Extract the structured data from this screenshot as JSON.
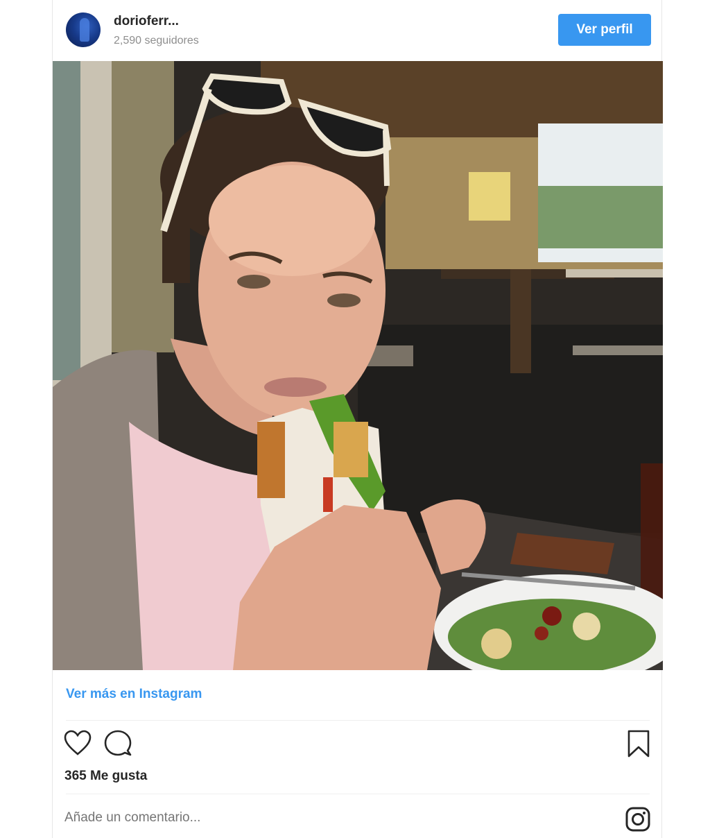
{
  "header": {
    "username": "dorioferr...",
    "followers": "2,590 seguidores",
    "profile_button": "Ver perfil"
  },
  "post": {
    "more_link": "Ver más en Instagram",
    "likes": "365 Me gusta",
    "comment_placeholder": "Añade un comentario..."
  },
  "icons": {
    "avatar": "profile-avatar",
    "like": "heart-icon",
    "comment": "comment-bubble-icon",
    "save": "bookmark-icon",
    "instagram": "instagram-logo-icon"
  },
  "colors": {
    "accent": "#3897f0",
    "text": "#262626",
    "muted": "#8e8e8e"
  }
}
